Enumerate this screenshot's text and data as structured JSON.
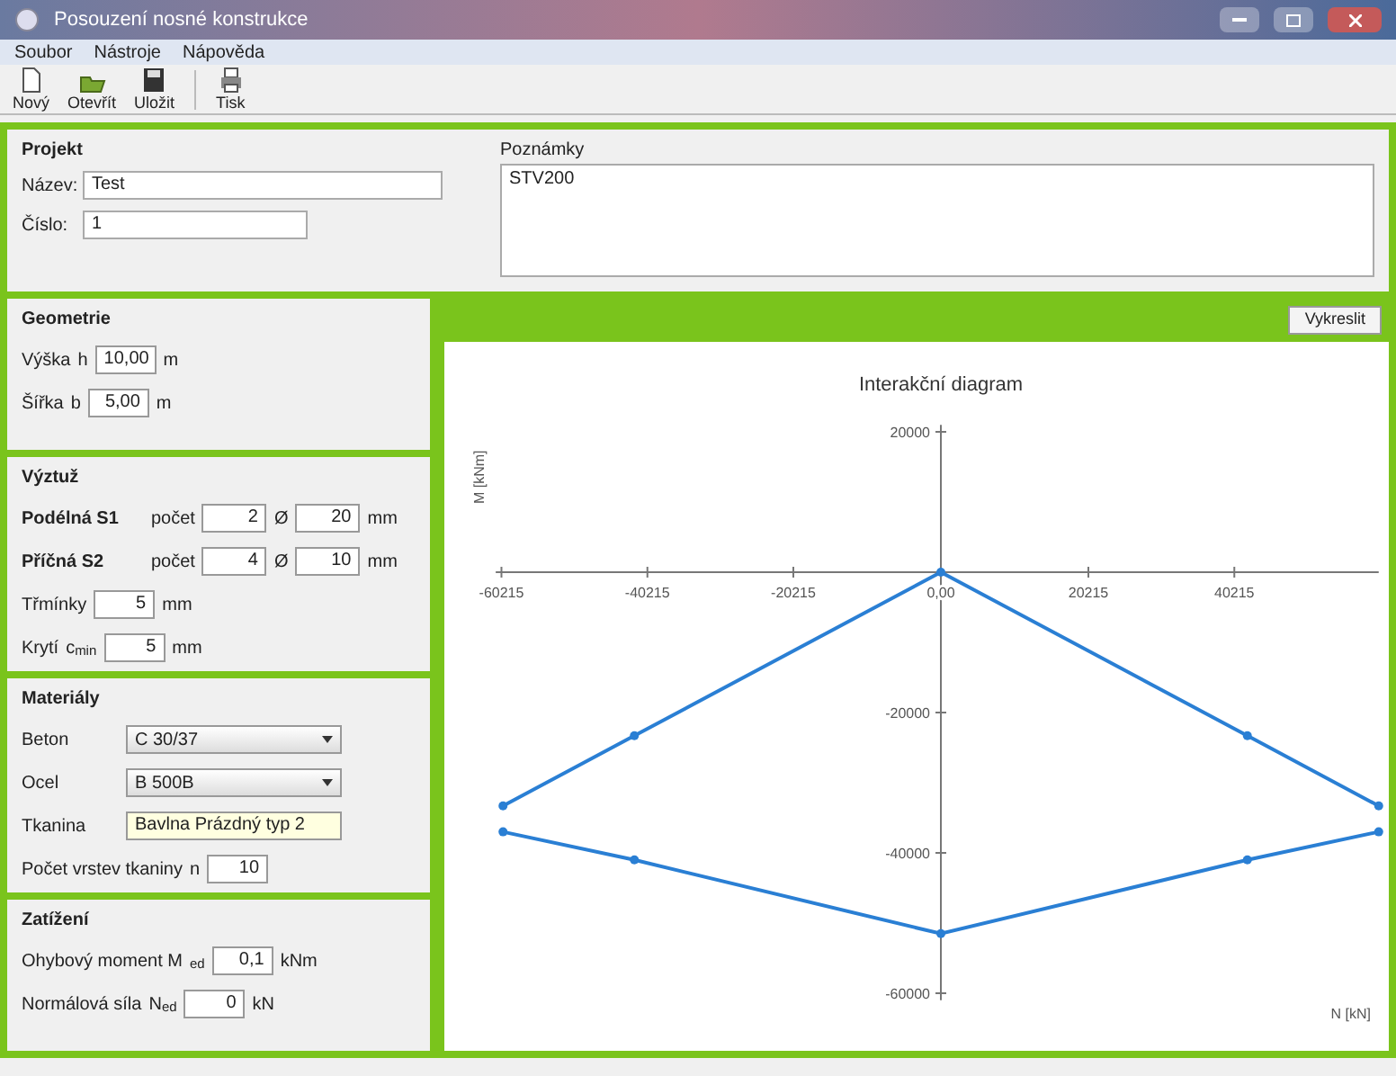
{
  "window": {
    "title": "Posouzení nosné konstrukce"
  },
  "menu": [
    "Soubor",
    "Nástroje",
    "Nápověda"
  ],
  "toolbar": [
    {
      "kind": "new",
      "label": "Nový"
    },
    {
      "kind": "open",
      "label": "Otevřít"
    },
    {
      "kind": "save",
      "label": "Uložit"
    },
    {
      "kind": "print",
      "label": "Tisk"
    }
  ],
  "project": {
    "title": "Projekt",
    "fields": [
      {
        "label": "Název:",
        "value": "Test"
      },
      {
        "label": "Číslo:",
        "value": "1"
      }
    ],
    "notes": {
      "label": "Poznámky",
      "value": "STV200"
    }
  },
  "sections": [
    {
      "title": "Geometrie",
      "rows": [
        {
          "kind": "input",
          "label": "Výška",
          "symbol": "h",
          "value": "10,00",
          "unit": "m"
        },
        {
          "kind": "input",
          "label": "Šířka",
          "symbol": "b",
          "value": "5,00",
          "unit": "m"
        }
      ]
    },
    {
      "title": "Výztuž",
      "rows": [
        {
          "kind": "bar",
          "label": "Podélná S1",
          "count_label": "počet",
          "count": "2",
          "dia_symbol": "Ø",
          "dia": "20",
          "unit": "mm"
        },
        {
          "kind": "bar",
          "label": "Příčná S2",
          "count_label": "počet",
          "count": "4",
          "dia_symbol": "Ø",
          "dia": "10",
          "unit": "mm"
        },
        {
          "kind": "input",
          "label": "Třmínky",
          "value": "5",
          "unit": "mm"
        },
        {
          "kind": "input",
          "label": "Krytí",
          "symbol": "c$_{min}$",
          "value": "5",
          "unit": "mm"
        }
      ]
    },
    {
      "title": "Materiály",
      "rows": [
        {
          "kind": "select",
          "label": "Beton",
          "value": "C 30/37"
        },
        {
          "kind": "select",
          "label": "Ocel",
          "value": "B 500B"
        },
        {
          "kind": "text",
          "label": "Tkanina",
          "value": "Bavlna Prázdný typ 2"
        },
        {
          "kind": "input",
          "label": "Počet vrstev tkaniny",
          "symbol": "n",
          "value": "10"
        }
      ]
    },
    {
      "title": "Zatížení",
      "rows": [
        {
          "kind": "input",
          "label": "Ohybový moment M",
          "symbol": "$_{ed}$",
          "value": "0,1",
          "unit": "kNm"
        },
        {
          "kind": "input",
          "label": "Normálová síla",
          "symbol": "N$_{ed}$",
          "value": "0",
          "unit": "kN"
        }
      ]
    }
  ],
  "chart_panel": {
    "button": "Vykreslit",
    "chart_data": {
      "type": "line",
      "title": "Interakční diagram",
      "ylabel": "M [kNm]",
      "annotations": [
        {
          "text": "N [kN]"
        }
      ],
      "xlim": [
        -61000,
        60000
      ],
      "ylim": [
        -61000,
        21000
      ],
      "x": [
        -60000,
        -42000,
        0,
        42000,
        60000
      ],
      "series": [
        {
          "color": "#2a7fd4",
          "marker": "circle",
          "values": [
            -33300,
            -23300,
            0,
            -23300,
            -33300
          ]
        },
        {
          "color": "#2a7fd4",
          "marker": "circle",
          "values": [
            -37000,
            -41000,
            -51500,
            -41000,
            -37000
          ]
        }
      ],
      "xticks": [
        -60215,
        -40215,
        -20215,
        {
          "value": 0,
          "label": "0,00"
        },
        20215,
        40215
      ],
      "yticks": [
        20000,
        -20000,
        -40000,
        -60000
      ]
    }
  }
}
